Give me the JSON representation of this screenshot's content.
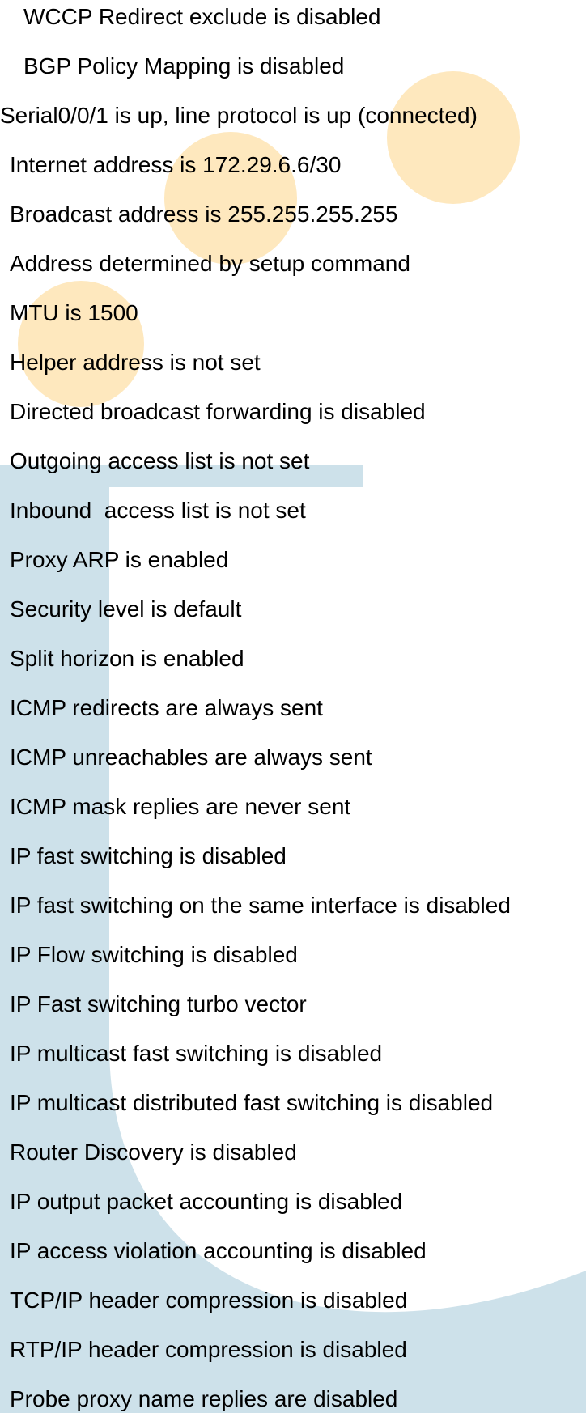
{
  "decor": {
    "circle_color": "#FEE8BE",
    "stripe_color": "#CDE1EA"
  },
  "output": {
    "lines": [
      "WCCP Redirect exclude is disabled",
      "BGP Policy Mapping is disabled",
      "Serial0/0/1 is up, line protocol is up (connected)",
      "Internet address is 172.29.6.6/30",
      "Broadcast address is 255.255.255.255",
      "Address determined by setup command",
      "MTU is 1500",
      "Helper address is not set",
      "Directed broadcast forwarding is disabled",
      "Outgoing access list is not set",
      "Inbound  access list is not set",
      "Proxy ARP is enabled",
      "Security level is default",
      "Split horizon is enabled",
      "ICMP redirects are always sent",
      "ICMP unreachables are always sent",
      "ICMP mask replies are never sent",
      "IP fast switching is disabled",
      "IP fast switching on the same interface is disabled",
      "IP Flow switching is disabled",
      "IP Fast switching turbo vector",
      "IP multicast fast switching is disabled",
      "IP multicast distributed fast switching is disabled",
      "Router Discovery is disabled",
      "IP output packet accounting is disabled",
      "IP access violation accounting is disabled",
      "TCP/IP header compression is disabled",
      "RTP/IP header compression is disabled",
      "Probe proxy name replies are disabled"
    ]
  }
}
